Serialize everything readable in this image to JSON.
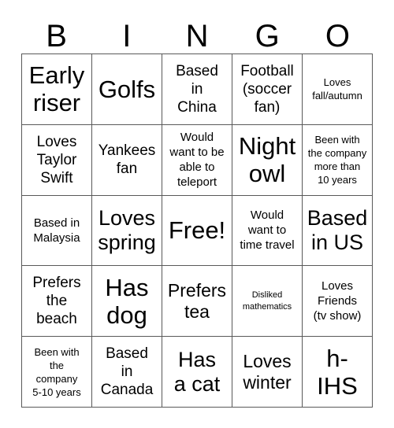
{
  "card": {
    "header_letters": [
      "B",
      "I",
      "N",
      "G",
      "O"
    ],
    "columns": 5,
    "rows": 5,
    "border_color": "#595959",
    "background_color": "#ffffff",
    "text_color": "#000000",
    "free_space": {
      "row": 3,
      "column": 3,
      "label": "Free!"
    },
    "cells": [
      {
        "id": "b1",
        "column": "B",
        "row": 1,
        "text": "Early\nriser",
        "size": "fs-xxl"
      },
      {
        "id": "i1",
        "column": "I",
        "row": 1,
        "text": "Golfs",
        "size": "fs-xxl"
      },
      {
        "id": "n1",
        "column": "N",
        "row": 1,
        "text": "Based\nin\nChina",
        "size": "fs-md"
      },
      {
        "id": "g1",
        "column": "G",
        "row": 1,
        "text": "Football\n(soccer\nfan)",
        "size": "fs-md"
      },
      {
        "id": "o1",
        "column": "O",
        "row": 1,
        "text": "Loves\nfall/autumn",
        "size": "fs-xs"
      },
      {
        "id": "b2",
        "column": "B",
        "row": 2,
        "text": "Loves\nTaylor\nSwift",
        "size": "fs-md"
      },
      {
        "id": "i2",
        "column": "I",
        "row": 2,
        "text": "Yankees\nfan",
        "size": "fs-md"
      },
      {
        "id": "n2",
        "column": "N",
        "row": 2,
        "text": "Would\nwant to be\nable to\nteleport",
        "size": "fs-sm"
      },
      {
        "id": "g2",
        "column": "G",
        "row": 2,
        "text": "Night\nowl",
        "size": "fs-xxl"
      },
      {
        "id": "o2",
        "column": "O",
        "row": 2,
        "text": "Been with\nthe company\nmore than\n10 years",
        "size": "fs-xs"
      },
      {
        "id": "b3",
        "column": "B",
        "row": 3,
        "text": "Based in\nMalaysia",
        "size": "fs-sm"
      },
      {
        "id": "i3",
        "column": "I",
        "row": 3,
        "text": "Loves\nspring",
        "size": "fs-xl"
      },
      {
        "id": "n3",
        "column": "N",
        "row": 3,
        "text": "Free!",
        "size": "fs-xxl"
      },
      {
        "id": "g3",
        "column": "G",
        "row": 3,
        "text": "Would\nwant to\ntime travel",
        "size": "fs-sm"
      },
      {
        "id": "o3",
        "column": "O",
        "row": 3,
        "text": "Based\nin US",
        "size": "fs-xl"
      },
      {
        "id": "b4",
        "column": "B",
        "row": 4,
        "text": "Prefers\nthe\nbeach",
        "size": "fs-md"
      },
      {
        "id": "i4",
        "column": "I",
        "row": 4,
        "text": "Has\ndog",
        "size": "fs-xxl"
      },
      {
        "id": "n4",
        "column": "N",
        "row": 4,
        "text": "Prefers\ntea",
        "size": "fs-lg"
      },
      {
        "id": "g4",
        "column": "G",
        "row": 4,
        "text": "Disliked\nmathematics",
        "size": "fs-xxs"
      },
      {
        "id": "o4",
        "column": "O",
        "row": 4,
        "text": "Loves\nFriends\n(tv show)",
        "size": "fs-sm"
      },
      {
        "id": "b5",
        "column": "B",
        "row": 5,
        "text": "Been with\nthe\ncompany\n5-10 years",
        "size": "fs-xs"
      },
      {
        "id": "i5",
        "column": "I",
        "row": 5,
        "text": "Based\nin\nCanada",
        "size": "fs-md"
      },
      {
        "id": "n5",
        "column": "N",
        "row": 5,
        "text": "Has\na cat",
        "size": "fs-xl"
      },
      {
        "id": "g5",
        "column": "G",
        "row": 5,
        "text": "Loves\nwinter",
        "size": "fs-lg"
      },
      {
        "id": "o5",
        "column": "O",
        "row": 5,
        "text": "h-\nIHS",
        "size": "fs-xxl"
      }
    ]
  }
}
